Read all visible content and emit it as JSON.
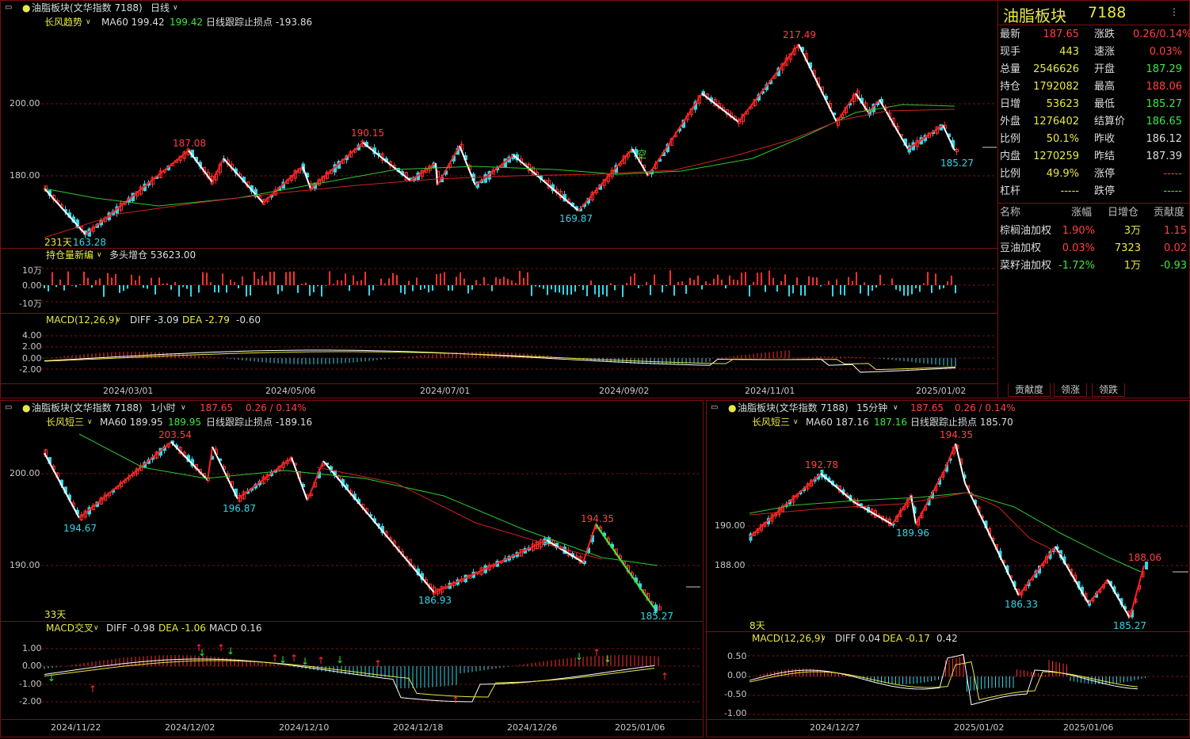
{
  "daily": {
    "title": "油脂板块(文华指数 7188)",
    "period": "日线",
    "indicator": "长风趋势",
    "ma_label": "MA60 199.42",
    "ma_val": "199.42",
    "stop_label": "日线跟踪止损点 -193.86",
    "days": "231天",
    "y_labels": [
      "200.00",
      "180.00"
    ],
    "peaks": [
      "217.49",
      "187.08",
      "190.15",
      "163.28",
      "169.87",
      "185.27"
    ],
    "mark_kong": "空",
    "vol_title": "持仓量新编",
    "vol_sub": "多头增仓 53623.00",
    "vol_y": [
      "10万",
      "0.00",
      "-10万"
    ],
    "macd_title": "MACD(12,26,9)",
    "macd_diff": "DIFF -3.09",
    "macd_dea": "DEA -2.79",
    "macd_val": "-0.60",
    "macd_y": [
      "4.00",
      "2.00",
      "0.00",
      "-2.00"
    ],
    "dates": [
      "2024/03/01",
      "2024/05/06",
      "2024/07/01",
      "2024/09/02",
      "2024/11/01",
      "2025/01/02"
    ]
  },
  "quote": {
    "name": "油脂板块",
    "code": "7188",
    "rows": [
      {
        "k1": "最新",
        "v1": "187.65",
        "k2": "涨跌",
        "v2": "0.26/0.14%"
      },
      {
        "k1": "现手",
        "v1": "443",
        "k2": "速涨",
        "v2": "0.03%"
      },
      {
        "k1": "总量",
        "v1": "2546626",
        "k2": "开盘",
        "v2": "187.29"
      },
      {
        "k1": "持仓",
        "v1": "1792082",
        "k2": "最高",
        "v2": "188.06"
      },
      {
        "k1": "日增",
        "v1": "53623",
        "k2": "最低",
        "v2": "185.27"
      },
      {
        "k1": "外盘",
        "v1": "1276402",
        "k2": "结算价",
        "v2": "186.65"
      },
      {
        "k1": "比例",
        "v1": "50.1%",
        "k2": "昨收",
        "v2": "186.12"
      },
      {
        "k1": "内盘",
        "v1": "1270259",
        "k2": "昨结",
        "v2": "187.39"
      },
      {
        "k1": "比例",
        "v1": "49.9%",
        "k2": "涨停",
        "v2": "-----"
      },
      {
        "k1": "杠杆",
        "v1": "-----",
        "k2": "跌停",
        "v2": "-----"
      }
    ],
    "contrib_headers": [
      "名称",
      "涨幅",
      "日增仓",
      "贡献度"
    ],
    "contrib_rows": [
      {
        "name": "棕榈油加权",
        "chg": "1.90%",
        "oi": "3万",
        "c": "1.15"
      },
      {
        "name": "豆油加权",
        "chg": "0.03%",
        "oi": "7323",
        "c": "0.02"
      },
      {
        "name": "菜籽油加权",
        "chg": "-1.72%",
        "oi": "1万",
        "c": "-0.93"
      }
    ],
    "tabs": [
      "贡献度",
      "领涨",
      "领跌"
    ]
  },
  "hourly": {
    "title": "油脂板块(文华指数 7188)",
    "period": "1小时",
    "price": "187.65",
    "chg": "0.26 / 0.14%",
    "indicator": "长风短三",
    "ma_label": "MA60 189.95",
    "ma_val": "189.95",
    "stop_label": "日线跟踪止损点 -189.16",
    "days": "33天",
    "y_labels": [
      "200.00",
      "190.00"
    ],
    "peaks": [
      "203.54",
      "194.67",
      "196.87",
      "186.93",
      "194.35",
      "185.27"
    ],
    "macd_title": "MACD交叉",
    "macd_diff": "DIFF -0.98",
    "macd_dea": "DEA -1.06",
    "macd_val": "MACD 0.16",
    "macd_y": [
      "1.00",
      "0.00",
      "-1.00",
      "-2.00"
    ],
    "dates": [
      "2024/11/22",
      "2024/12/02",
      "2024/12/10",
      "2024/12/18",
      "2024/12/26",
      "2025/01/06"
    ]
  },
  "min15": {
    "title": "油脂板块(文华指数 7188)",
    "period": "15分钟",
    "price": "187.65",
    "chg": "0.26 / 0.14%",
    "indicator": "长风短三",
    "ma_label": "MA60 187.16",
    "ma_val": "187.16",
    "stop_label": "日线跟踪止损点 185.70",
    "days": "8天",
    "y_labels": [
      "190.00",
      "188.00"
    ],
    "peaks": [
      "194.35",
      "192.78",
      "189.96",
      "186.33",
      "188.06",
      "185.27"
    ],
    "macd_title": "MACD(12,26,9)",
    "macd_diff": "DIFF 0.04",
    "macd_dea": "DEA -0.17",
    "macd_val": "0.42",
    "macd_y": [
      "0.50",
      "0.00",
      "-0.50",
      "-1.00"
    ],
    "dates": [
      "2024/12/27",
      "2025/01/02",
      "2025/01/06"
    ]
  },
  "colors": {
    "up": "#ff3030",
    "down": "#35d6e8",
    "ma": "#2ec82e",
    "frame": "#7a1010",
    "text_yellow": "#e8e845"
  }
}
